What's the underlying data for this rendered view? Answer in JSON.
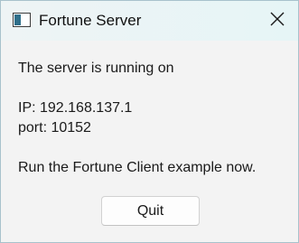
{
  "window": {
    "title": "Fortune Server",
    "icon": "app-window-icon",
    "close_icon": "close-icon"
  },
  "message": {
    "line1": "The server is running on",
    "ip_line": "IP: 192.168.137.1",
    "port_line": "port: 10152",
    "instruction": "Run the Fortune Client example now."
  },
  "buttons": {
    "quit_label": "Quit"
  },
  "colors": {
    "titlebar": "#e8f4f5",
    "background": "#f3f3f3",
    "border": "#a8c2cc",
    "button_bg": "#fdfdfd"
  }
}
